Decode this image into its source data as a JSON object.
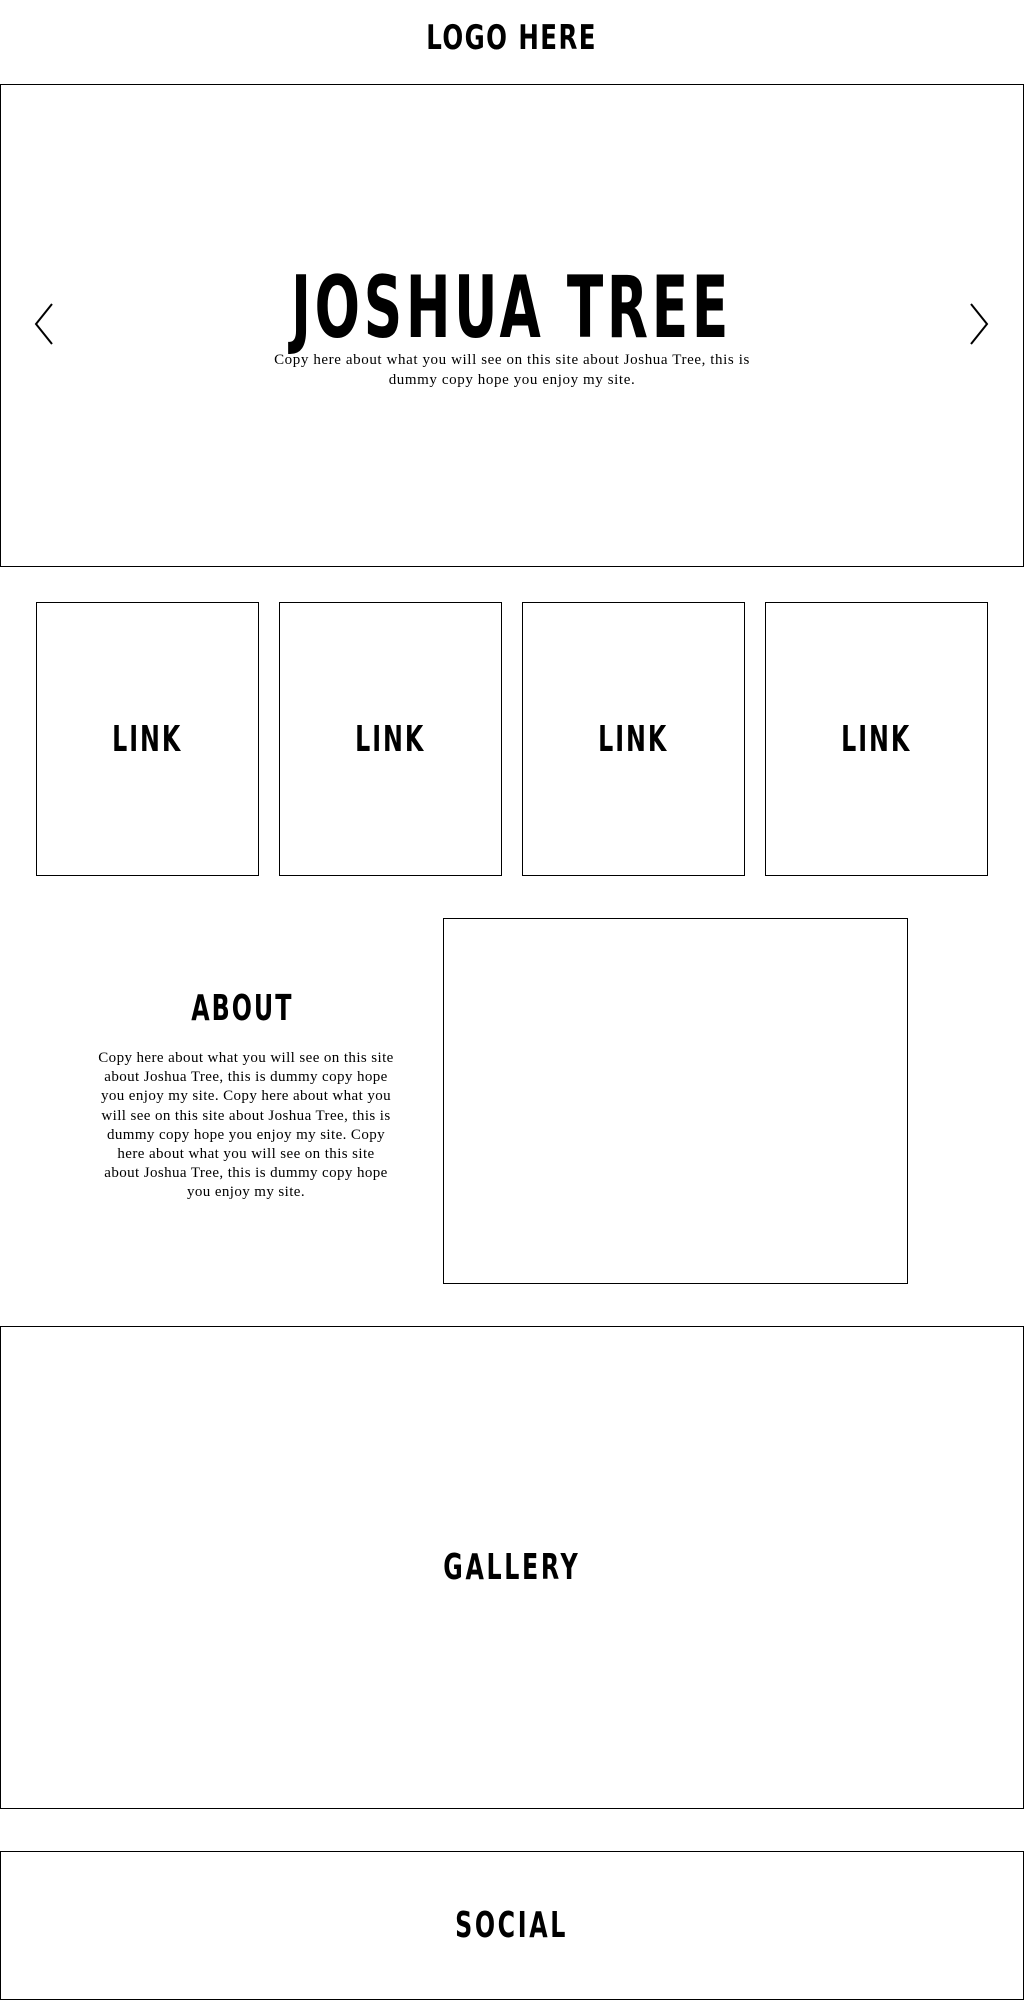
{
  "header": {
    "logo_text": "LOGO HERE"
  },
  "hero": {
    "title": "JOSHUA TREE",
    "copy": "Copy here about what you will see on this site about Joshua Tree, this is dummy copy hope you enjoy my site.",
    "prev_icon": "chevron-left-icon",
    "next_icon": "chevron-right-icon"
  },
  "links": {
    "items": [
      {
        "label": "LINK"
      },
      {
        "label": "LINK"
      },
      {
        "label": "LINK"
      },
      {
        "label": "LINK"
      }
    ]
  },
  "about": {
    "title": "ABOUT",
    "copy": "Copy here about what you will see on this site about Joshua Tree, this is dummy copy hope you enjoy my site. Copy here about what you will see on this site about Joshua Tree, this is dummy copy hope you enjoy my site. Copy here about what you will see on this site about Joshua Tree, this is dummy copy hope you enjoy my site."
  },
  "gallery": {
    "label": "GALLERY"
  },
  "social": {
    "label": "SOCIAL"
  },
  "colors": {
    "background": "#ffffff",
    "stroke": "#000000"
  }
}
